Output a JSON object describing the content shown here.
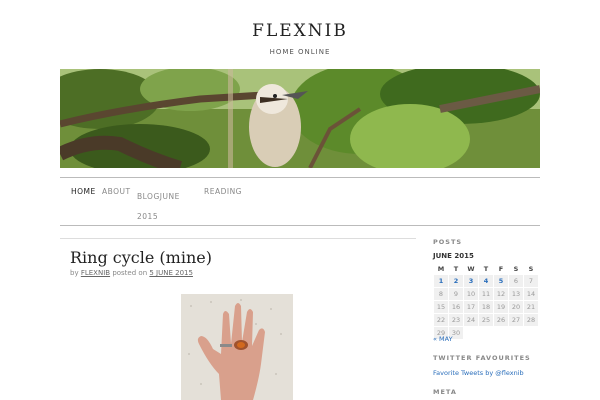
{
  "site": {
    "title": "FLEXNIB",
    "description": "HOME ONLINE"
  },
  "nav": {
    "items": [
      {
        "label": "HOME",
        "current": true
      },
      {
        "label": "ABOUT",
        "current": false
      },
      {
        "label": "BLOGJUNE 2015",
        "current": false
      },
      {
        "label": "READING",
        "current": false
      }
    ]
  },
  "post": {
    "title": "Ring cycle (mine)",
    "meta_by": "by",
    "author": "FLEXNIB",
    "meta_posted": "posted on",
    "date": "5 JUNE 2015"
  },
  "sidebar": {
    "posts_title": "POSTS",
    "calendar": {
      "caption": "JUNE 2015",
      "weekdays": [
        "M",
        "T",
        "W",
        "T",
        "F",
        "S",
        "S"
      ],
      "weeks": [
        [
          1,
          2,
          3,
          4,
          5,
          6,
          7
        ],
        [
          8,
          9,
          10,
          11,
          12,
          13,
          14
        ],
        [
          15,
          16,
          17,
          18,
          19,
          20,
          21
        ],
        [
          22,
          23,
          24,
          25,
          26,
          27,
          28
        ],
        [
          29,
          30,
          "",
          "",
          "",
          "",
          ""
        ]
      ],
      "linked_days": [
        1,
        2,
        3,
        4,
        5
      ]
    },
    "prev_month": "« MAY",
    "twitter_title": "TWITTER FAVOURITES",
    "twitter_link": "Favorite Tweets by @flexnib",
    "meta_title": "META"
  },
  "colors": {
    "link": "#2a6ebb",
    "text": "#222222",
    "muted": "#888888"
  }
}
